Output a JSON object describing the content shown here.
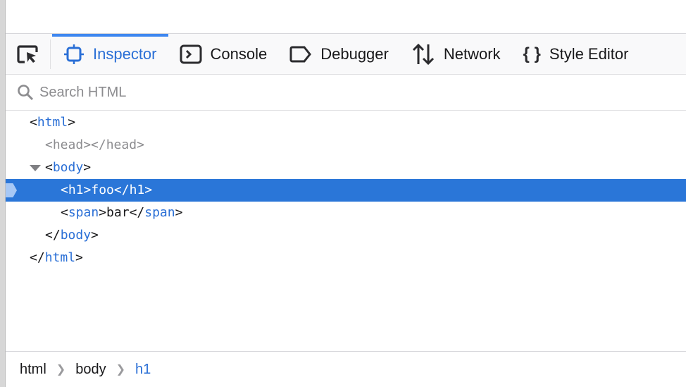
{
  "toolbar": {
    "tabs": [
      {
        "label": "Inspector",
        "icon": "inspector-icon",
        "active": true
      },
      {
        "label": "Console",
        "icon": "console-icon"
      },
      {
        "label": "Debugger",
        "icon": "debugger-icon"
      },
      {
        "label": "Network",
        "icon": "network-icon"
      },
      {
        "label": "Style Editor",
        "icon": "style-editor-icon"
      }
    ],
    "accent": "#2a6fd6"
  },
  "search": {
    "placeholder": "Search HTML"
  },
  "markup": {
    "html_tag": "html",
    "head_tag": "head",
    "body_tag": "body",
    "h1_tag": "h1",
    "h1_text": "foo",
    "span_tag": "span",
    "span_text": "bar"
  },
  "breadcrumbs": [
    "html",
    "body",
    "h1"
  ],
  "selection_color": "#2a76d8"
}
